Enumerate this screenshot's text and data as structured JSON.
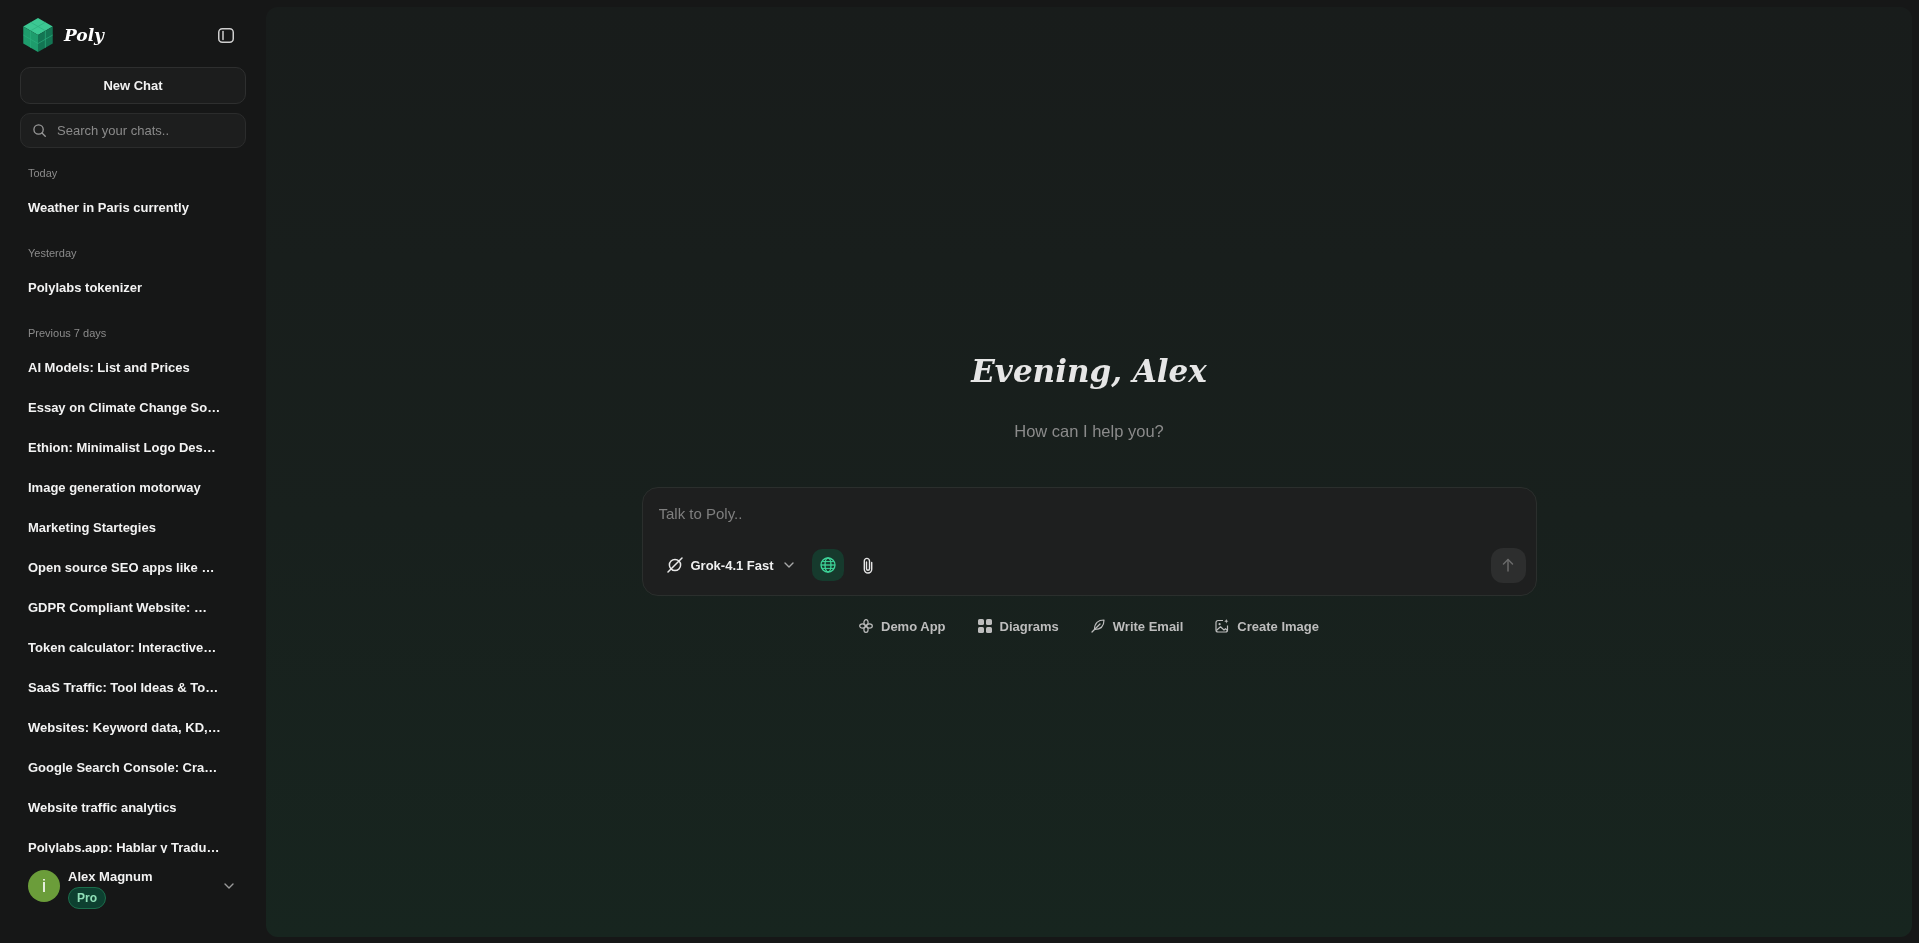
{
  "sidebar": {
    "brand": "Poly",
    "new_chat": "New Chat",
    "search": {
      "placeholder": "Search your chats.."
    },
    "groups": [
      {
        "label": "Today",
        "chats": [
          "Weather in Paris currently"
        ]
      },
      {
        "label": "Yesterday",
        "chats": [
          "Polylabs tokenizer"
        ]
      },
      {
        "label": "Previous 7 days",
        "chats": [
          "AI Models: List and Prices",
          "Essay on Climate Change So…",
          "Ethion: Minimalist Logo Des…",
          "Image generation motorway",
          "Marketing Startegies",
          "Open source SEO apps like …",
          "GDPR Compliant Website: …",
          "Token calculator: Interactive…",
          "SaaS Traffic: Tool Ideas & To…",
          "Websites: Keyword data, KD,…",
          "Google Search Console: Cra…",
          "Website traffic analytics",
          "Polylabs.app: Hablar y Tradu…"
        ]
      }
    ],
    "user": {
      "avatar": "i",
      "name": "Alex Magnum",
      "plan": "Pro"
    }
  },
  "main": {
    "greeting": "Evening, Alex",
    "subtitle": "How can I help you?",
    "composer": {
      "placeholder": "Talk to Poly..",
      "model": "Grok-4.1 Fast",
      "tools": [
        {
          "kind": "web-search",
          "on": true
        },
        {
          "kind": "attach",
          "on": false
        }
      ],
      "send": {
        "disabled": true
      }
    },
    "suggestions": [
      {
        "kind": "demo-app",
        "label": "Demo App"
      },
      {
        "kind": "diagrams",
        "label": "Diagrams"
      },
      {
        "kind": "write-email",
        "label": "Write Email"
      },
      {
        "kind": "create-image",
        "label": "Create Image"
      }
    ]
  }
}
